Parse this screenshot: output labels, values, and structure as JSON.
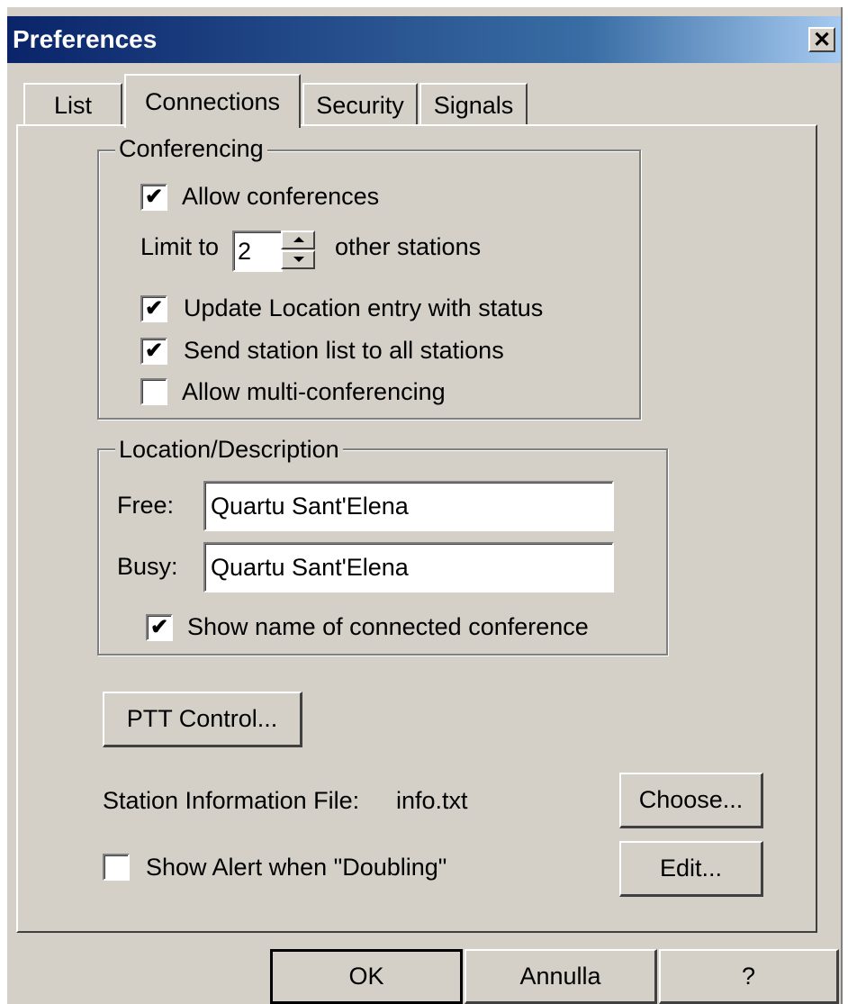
{
  "window": {
    "title": "Preferences",
    "close_symbol": "✕",
    "close_icon": "close-icon"
  },
  "tabs": [
    {
      "label": "List",
      "active": false
    },
    {
      "label": "Connections",
      "active": true
    },
    {
      "label": "Security",
      "active": false
    },
    {
      "label": "Signals",
      "active": false
    }
  ],
  "conferencing": {
    "title": "Conferencing",
    "allow_conferences": {
      "label": "Allow conferences",
      "checked": true
    },
    "limit_prefix": "Limit to",
    "limit_value": "2",
    "limit_suffix": "other stations",
    "update_location": {
      "label": "Update Location entry with status",
      "checked": true
    },
    "send_station_list": {
      "label": "Send station list to all stations",
      "checked": true
    },
    "allow_multi": {
      "label": "Allow multi-conferencing",
      "checked": false
    }
  },
  "location": {
    "title": "Location/Description",
    "free_label": "Free:",
    "free_value": "Quartu Sant'Elena",
    "busy_label": "Busy:",
    "busy_value": "Quartu Sant'Elena",
    "show_conference_name": {
      "label": "Show name of connected conference",
      "checked": true
    }
  },
  "ptt_button": "PTT Control...",
  "station_info": {
    "label": "Station Information File:",
    "value": "info.txt",
    "choose_button": "Choose..."
  },
  "doubling_alert": {
    "label": "Show Alert when \"Doubling\"",
    "checked": false
  },
  "edit_button": "Edit...",
  "footer": {
    "ok": "OK",
    "cancel": "Annulla",
    "help": "?"
  },
  "check_mark": "✔",
  "colors": {
    "face": "#d4d0c8",
    "title_start": "#0a246a",
    "title_end": "#a6caf0"
  }
}
